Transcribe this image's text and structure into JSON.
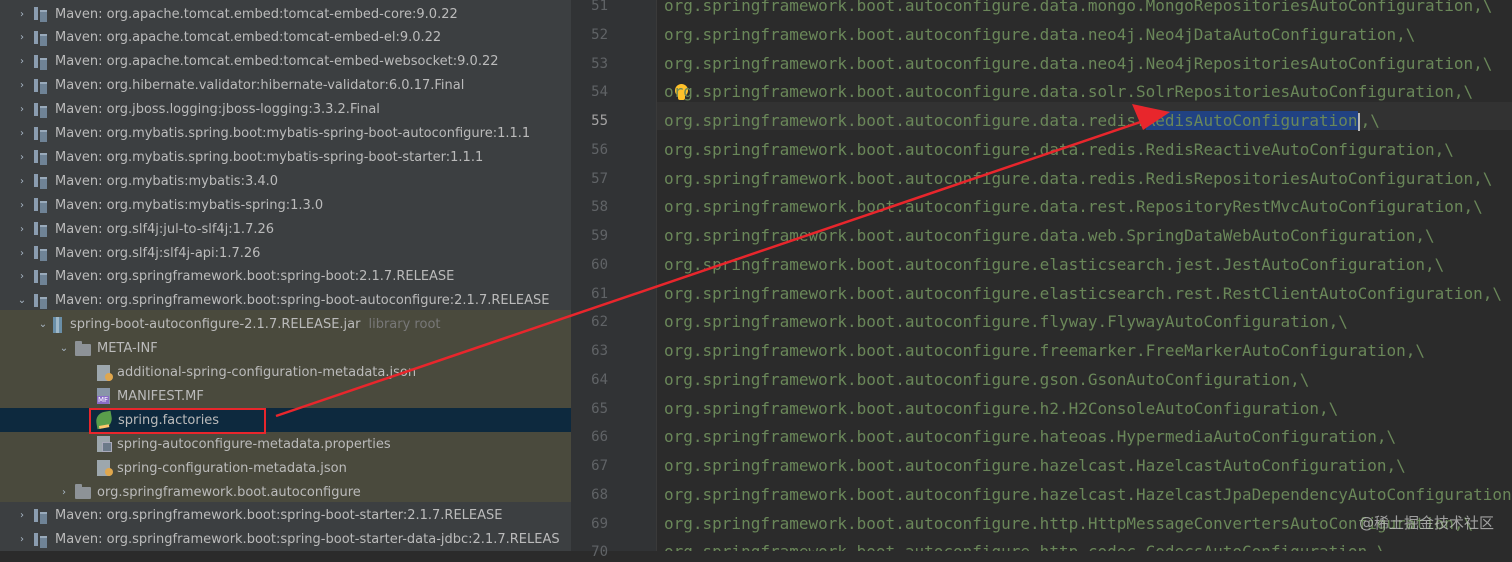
{
  "tree": [
    {
      "indent": 0,
      "arrow": "›",
      "icon": "lib",
      "label": "Maven: org.apache.tomcat.embed:tomcat-embed-core:9.0.22"
    },
    {
      "indent": 0,
      "arrow": "›",
      "icon": "lib",
      "label": "Maven: org.apache.tomcat.embed:tomcat-embed-el:9.0.22"
    },
    {
      "indent": 0,
      "arrow": "›",
      "icon": "lib",
      "label": "Maven: org.apache.tomcat.embed:tomcat-embed-websocket:9.0.22"
    },
    {
      "indent": 0,
      "arrow": "›",
      "icon": "lib",
      "label": "Maven: org.hibernate.validator:hibernate-validator:6.0.17.Final"
    },
    {
      "indent": 0,
      "arrow": "›",
      "icon": "lib",
      "label": "Maven: org.jboss.logging:jboss-logging:3.3.2.Final"
    },
    {
      "indent": 0,
      "arrow": "›",
      "icon": "lib",
      "label": "Maven: org.mybatis.spring.boot:mybatis-spring-boot-autoconfigure:1.1.1"
    },
    {
      "indent": 0,
      "arrow": "›",
      "icon": "lib",
      "label": "Maven: org.mybatis.spring.boot:mybatis-spring-boot-starter:1.1.1"
    },
    {
      "indent": 0,
      "arrow": "›",
      "icon": "lib",
      "label": "Maven: org.mybatis:mybatis:3.4.0"
    },
    {
      "indent": 0,
      "arrow": "›",
      "icon": "lib",
      "label": "Maven: org.mybatis:mybatis-spring:1.3.0"
    },
    {
      "indent": 0,
      "arrow": "›",
      "icon": "lib",
      "label": "Maven: org.slf4j:jul-to-slf4j:1.7.26"
    },
    {
      "indent": 0,
      "arrow": "›",
      "icon": "lib",
      "label": "Maven: org.slf4j:slf4j-api:1.7.26"
    },
    {
      "indent": 0,
      "arrow": "›",
      "icon": "lib",
      "label": "Maven: org.springframework.boot:spring-boot:2.1.7.RELEASE"
    },
    {
      "indent": 0,
      "arrow": "⌄",
      "icon": "lib",
      "label": "Maven: org.springframework.boot:spring-boot-autoconfigure:2.1.7.RELEASE"
    },
    {
      "indent": 1,
      "arrow": "⌄",
      "icon": "jar",
      "label": "spring-boot-autoconfigure-2.1.7.RELEASE.jar",
      "sub": "library root"
    },
    {
      "indent": 2,
      "arrow": "⌄",
      "icon": "folder",
      "label": "META-INF"
    },
    {
      "indent": 3,
      "arrow": "",
      "icon": "file json",
      "label": "additional-spring-configuration-metadata.json"
    },
    {
      "indent": 3,
      "arrow": "",
      "icon": "file mf",
      "label": "MANIFEST.MF"
    },
    {
      "indent": 3,
      "arrow": "",
      "icon": "leaf",
      "label": "spring.factories",
      "selected": true
    },
    {
      "indent": 3,
      "arrow": "",
      "icon": "file prop",
      "label": "spring-autoconfigure-metadata.properties"
    },
    {
      "indent": 3,
      "arrow": "",
      "icon": "file json",
      "label": "spring-configuration-metadata.json"
    },
    {
      "indent": 2,
      "arrow": "›",
      "icon": "folder",
      "label": "org.springframework.boot.autoconfigure"
    },
    {
      "indent": 0,
      "arrow": "›",
      "icon": "lib",
      "label": "Maven: org.springframework.boot:spring-boot-starter:2.1.7.RELEASE"
    },
    {
      "indent": 0,
      "arrow": "›",
      "icon": "lib",
      "label": "Maven: org.springframework.boot:spring-boot-starter-data-jdbc:2.1.7.RELEAS"
    }
  ],
  "editor": {
    "current_line": 55,
    "lines": [
      {
        "num": "51",
        "text": "org.springframework.boot.autoconfigure.data.mongo.MongoRepositoriesAutoConfiguration,\\"
      },
      {
        "num": "52",
        "text": "org.springframework.boot.autoconfigure.data.neo4j.Neo4jDataAutoConfiguration,\\"
      },
      {
        "num": "53",
        "text": "org.springframework.boot.autoconfigure.data.neo4j.Neo4jRepositoriesAutoConfiguration,\\"
      },
      {
        "num": "54",
        "text": "org.springframework.boot.autoconfigure.data.solr.SolrRepositoriesAutoConfiguration,\\"
      },
      {
        "num": "55",
        "pre": "org.springframework.boot.autoconfigure.data.redis.",
        "hl": "RedisAutoConfiguration",
        "post": ",\\"
      },
      {
        "num": "56",
        "text": "org.springframework.boot.autoconfigure.data.redis.RedisReactiveAutoConfiguration,\\"
      },
      {
        "num": "57",
        "text": "org.springframework.boot.autoconfigure.data.redis.RedisRepositoriesAutoConfiguration,\\"
      },
      {
        "num": "58",
        "text": "org.springframework.boot.autoconfigure.data.rest.RepositoryRestMvcAutoConfiguration,\\"
      },
      {
        "num": "59",
        "text": "org.springframework.boot.autoconfigure.data.web.SpringDataWebAutoConfiguration,\\"
      },
      {
        "num": "60",
        "text": "org.springframework.boot.autoconfigure.elasticsearch.jest.JestAutoConfiguration,\\"
      },
      {
        "num": "61",
        "text": "org.springframework.boot.autoconfigure.elasticsearch.rest.RestClientAutoConfiguration,\\"
      },
      {
        "num": "62",
        "text": "org.springframework.boot.autoconfigure.flyway.FlywayAutoConfiguration,\\"
      },
      {
        "num": "63",
        "text": "org.springframework.boot.autoconfigure.freemarker.FreeMarkerAutoConfiguration,\\"
      },
      {
        "num": "64",
        "text": "org.springframework.boot.autoconfigure.gson.GsonAutoConfiguration,\\"
      },
      {
        "num": "65",
        "text": "org.springframework.boot.autoconfigure.h2.H2ConsoleAutoConfiguration,\\"
      },
      {
        "num": "66",
        "text": "org.springframework.boot.autoconfigure.hateoas.HypermediaAutoConfiguration,\\"
      },
      {
        "num": "67",
        "text": "org.springframework.boot.autoconfigure.hazelcast.HazelcastAutoConfiguration,\\"
      },
      {
        "num": "68",
        "text": "org.springframework.boot.autoconfigure.hazelcast.HazelcastJpaDependencyAutoConfiguration"
      },
      {
        "num": "69",
        "text": "org.springframework.boot.autoconfigure.http.HttpMessageConvertersAutoConfiguration,\\"
      },
      {
        "num": "70",
        "text": "org.springframework.boot.autoconfigure.http.codec.CodecsAutoConfiguration,\\"
      }
    ]
  },
  "watermark": "@稀土掘金技术社区",
  "colors": {
    "annotation_red": "#e8262c",
    "code_green": "#6a8759",
    "selection_blue": "#214283",
    "row_selected": "#0d293e"
  }
}
